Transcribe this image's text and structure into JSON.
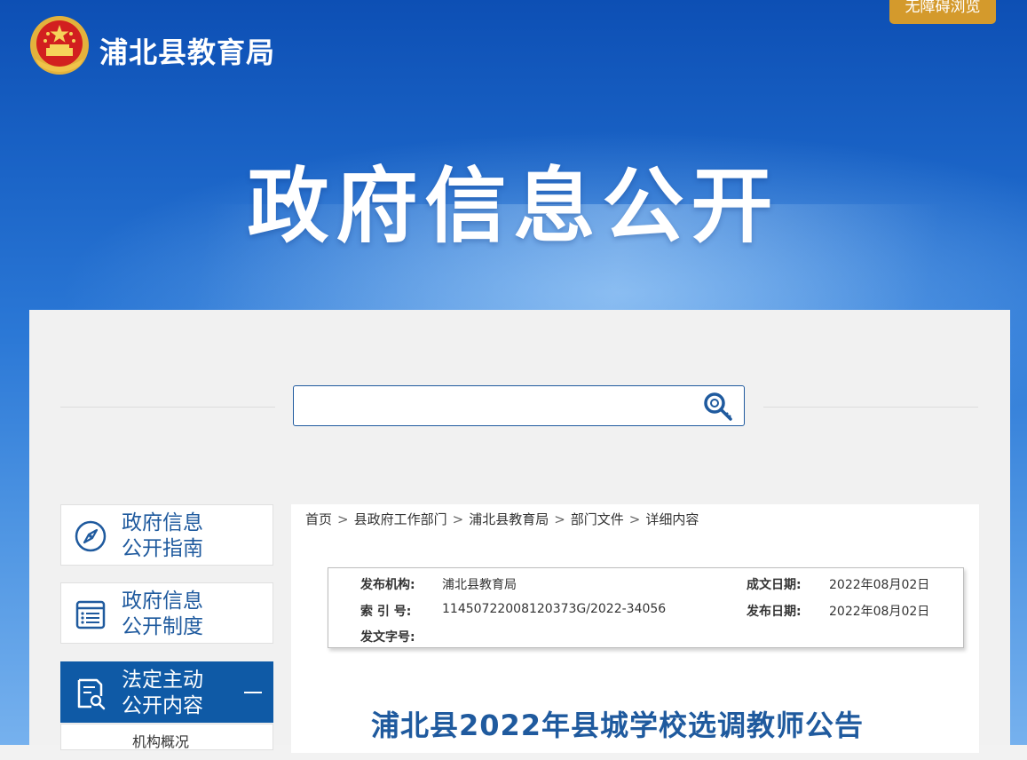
{
  "header": {
    "site_name": "浦北县教育局",
    "accessibility_label": "无障碍浏览",
    "hero_title": "政府信息公开"
  },
  "search": {
    "placeholder": ""
  },
  "sidebar": {
    "items": [
      {
        "label_line1": "政府信息",
        "label_line2": "公开指南",
        "icon": "compass-icon"
      },
      {
        "label_line1": "政府信息",
        "label_line2": "公开制度",
        "icon": "document-list-icon"
      },
      {
        "label_line1": "法定主动",
        "label_line2": "公开内容",
        "icon": "document-search-icon",
        "active": true
      }
    ],
    "sub_items": [
      {
        "label": "机构概况"
      }
    ]
  },
  "breadcrumb": [
    "首页",
    "县政府工作部门",
    "浦北县教育局",
    "部门文件",
    "详细内容"
  ],
  "meta": {
    "publisher_label": "发布机构:",
    "publisher": "浦北县教育局",
    "index_label": "索 引 号:",
    "index": "11450722008120373G/2022-34056",
    "doc_no_label": "发文字号:",
    "doc_no": "",
    "written_date_label": "成文日期:",
    "written_date": "2022年08月02日",
    "publish_date_label": "发布日期:",
    "publish_date": "2022年08月02日"
  },
  "document": {
    "title": "浦北县2022年县城学校选调教师公告"
  },
  "colors": {
    "accent": "#1f5a9e",
    "active_nav": "#0f5aa6",
    "access_btn": "#d49a2c"
  }
}
